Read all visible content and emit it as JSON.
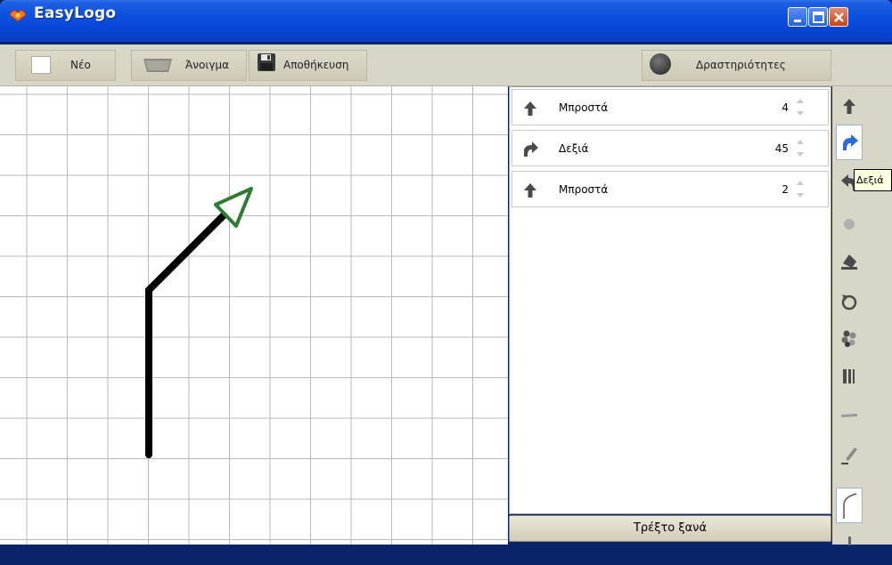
{
  "window": {
    "title": "EasyLogo"
  },
  "toolbar": {
    "new_label": "Νέο",
    "open_label": "Άνοιγμα",
    "save_label": "Αποθήκευση",
    "activities_label": "Δραστηριότητες"
  },
  "commands": [
    {
      "label": "Μπροστά",
      "value": "4",
      "icon": "arrow-up-icon"
    },
    {
      "label": "Δεξιά",
      "value": "45",
      "icon": "turn-right-icon"
    },
    {
      "label": "Μπροστά",
      "value": "2",
      "icon": "arrow-up-icon"
    }
  ],
  "run_button_label": "Τρέξτο ξανά",
  "tooltip": "Δεξιά",
  "side_tools": [
    "forward-icon",
    "turn-right-icon",
    "turn-left-icon",
    "pen-dot-icon",
    "fill-bucket-icon",
    "repeat-icon",
    "color-palette-icon",
    "pen-width-icon",
    "line-style-icon",
    "pen-icon",
    "curve-icon"
  ],
  "colors": {
    "titlebar": "#0b4fdd",
    "toolbar": "#d8d6c6",
    "active_tool": "#2a6bd8",
    "turtle": "#2e7d32"
  }
}
